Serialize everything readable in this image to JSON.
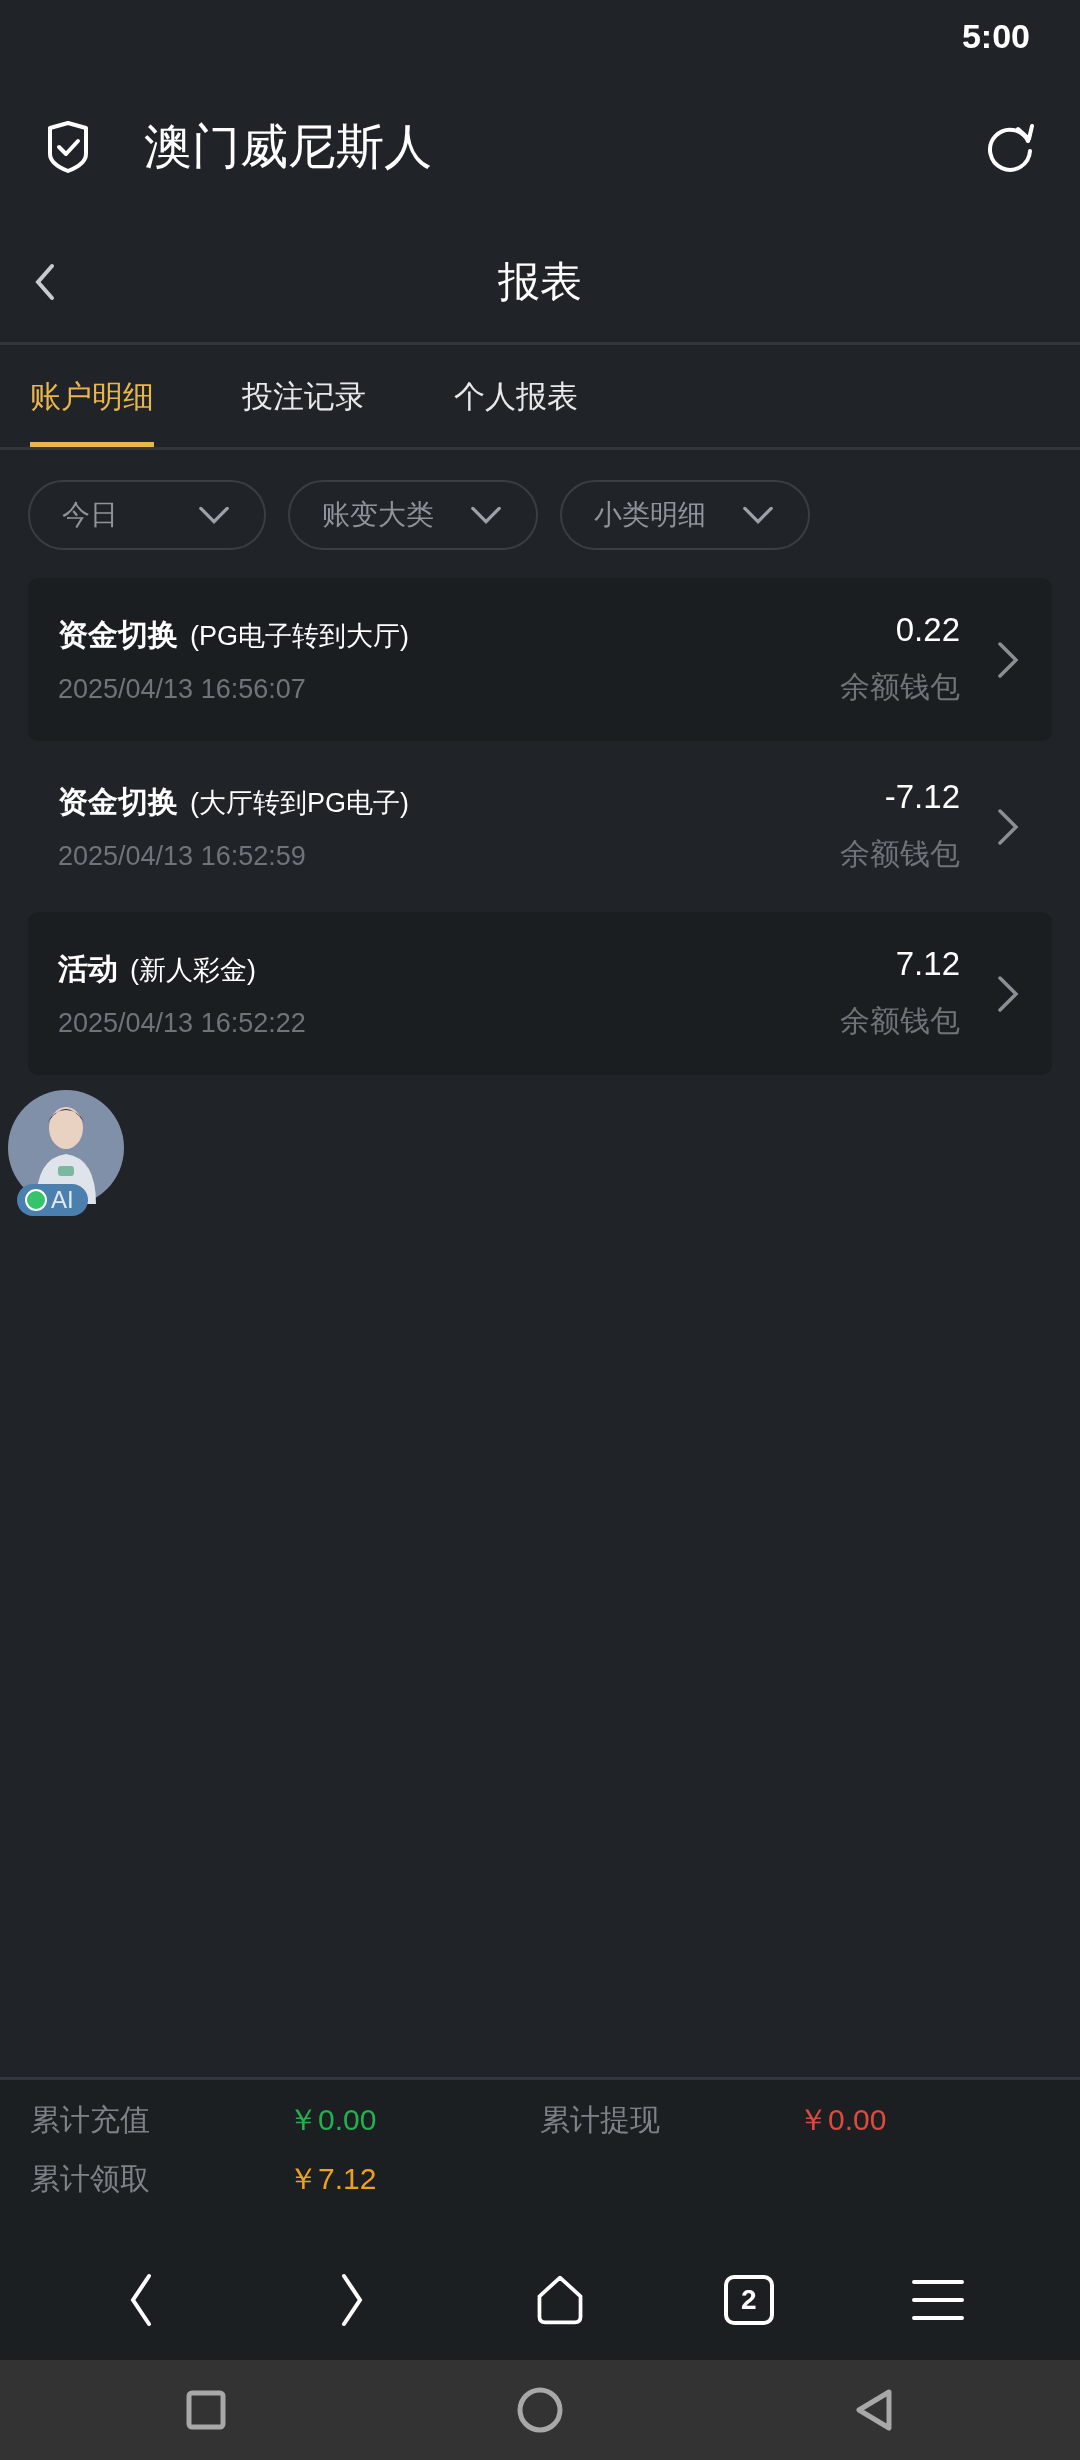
{
  "status_bar": {
    "time": "5:00"
  },
  "app_header": {
    "title": "澳门威尼斯人"
  },
  "page_header": {
    "title": "报表"
  },
  "tabs": [
    {
      "label": "账户明细",
      "selected": true
    },
    {
      "label": "投注记录",
      "selected": false
    },
    {
      "label": "个人报表",
      "selected": false
    }
  ],
  "filters": [
    {
      "label": "今日"
    },
    {
      "label": "账变大类"
    },
    {
      "label": "小类明细"
    }
  ],
  "records": [
    {
      "type": "资金切换",
      "detail": "(PG电子转到大厅)",
      "time": "2025/04/13 16:56:07",
      "amount": "0.22",
      "wallet": "余额钱包"
    },
    {
      "type": "资金切换",
      "detail": "(大厅转到PG电子)",
      "time": "2025/04/13 16:52:59",
      "amount": "-7.12",
      "wallet": "余额钱包"
    },
    {
      "type": "活动",
      "detail": "(新人彩金)",
      "time": "2025/04/13 16:52:22",
      "amount": "7.12",
      "wallet": "余额钱包"
    }
  ],
  "assistant_bubble": {
    "badge": "AI"
  },
  "summary": [
    {
      "label": "累计充值",
      "value": "￥0.00",
      "color": "#22b14c"
    },
    {
      "label": "累计提现",
      "value": "￥0.00",
      "color": "#e0493d"
    },
    {
      "label": "累计领取",
      "value": "￥7.12",
      "color": "#f0a020"
    }
  ],
  "browser_bar": {
    "tab_count": "2"
  }
}
